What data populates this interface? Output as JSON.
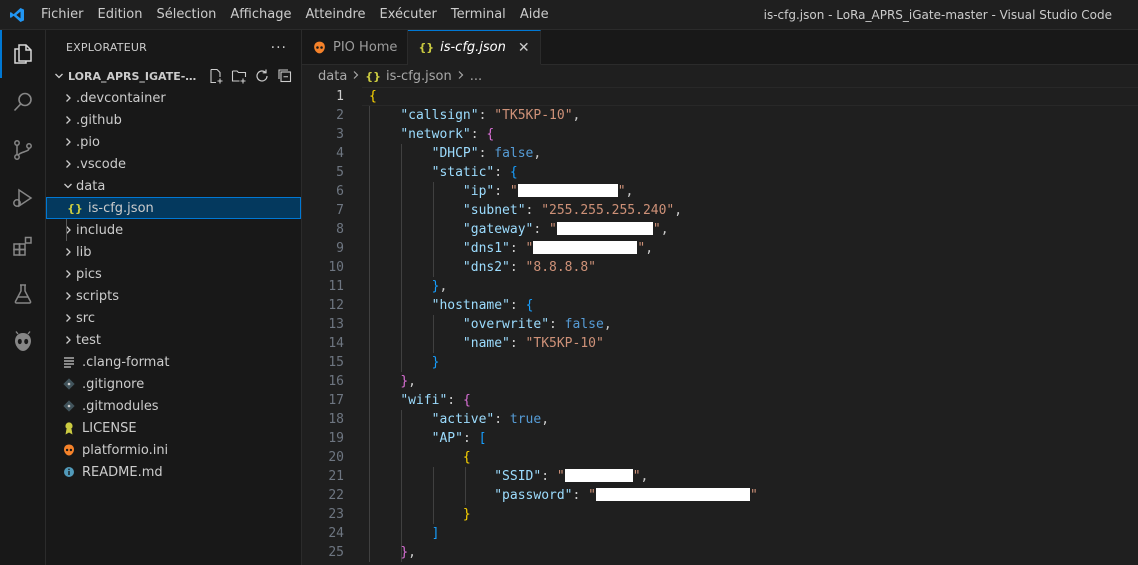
{
  "titlebar": {
    "menu": [
      "Fichier",
      "Edition",
      "Sélection",
      "Affichage",
      "Atteindre",
      "Exécuter",
      "Terminal",
      "Aide"
    ],
    "window_title": "is-cfg.json - LoRa_APRS_iGate-master - Visual Studio Code"
  },
  "sidebar": {
    "header": "EXPLORATEUR",
    "more": "···",
    "section_title": "LORA_APRS_IGATE-MAS...",
    "items": [
      {
        "label": ".devcontainer",
        "type": "folder"
      },
      {
        "label": ".github",
        "type": "folder"
      },
      {
        "label": ".pio",
        "type": "folder"
      },
      {
        "label": ".vscode",
        "type": "folder"
      },
      {
        "label": "data",
        "type": "folder-open"
      },
      {
        "label": "is-cfg.json",
        "type": "json",
        "selected": true
      },
      {
        "label": "include",
        "type": "folder"
      },
      {
        "label": "lib",
        "type": "folder"
      },
      {
        "label": "pics",
        "type": "folder"
      },
      {
        "label": "scripts",
        "type": "folder"
      },
      {
        "label": "src",
        "type": "folder"
      },
      {
        "label": "test",
        "type": "folder"
      },
      {
        "label": ".clang-format",
        "type": "lines"
      },
      {
        "label": ".gitignore",
        "type": "git"
      },
      {
        "label": ".gitmodules",
        "type": "git"
      },
      {
        "label": "LICENSE",
        "type": "license"
      },
      {
        "label": "platformio.ini",
        "type": "platformio"
      },
      {
        "label": "README.md",
        "type": "info"
      }
    ],
    "json_glyph": "{}"
  },
  "tabs": [
    {
      "label": "PIO Home",
      "active": false
    },
    {
      "label": "is-cfg.json",
      "active": true,
      "close": "✕"
    }
  ],
  "breadcrumbs": [
    "data",
    "is-cfg.json",
    "..."
  ],
  "breadcrumb_json_glyph": "{}",
  "editor": {
    "lines": [
      {
        "n": "1"
      },
      {
        "n": "2"
      },
      {
        "n": "3"
      },
      {
        "n": "4"
      },
      {
        "n": "5"
      },
      {
        "n": "6"
      },
      {
        "n": "7"
      },
      {
        "n": "8"
      },
      {
        "n": "9"
      },
      {
        "n": "10"
      },
      {
        "n": "11"
      },
      {
        "n": "12"
      },
      {
        "n": "13"
      },
      {
        "n": "14"
      },
      {
        "n": "15"
      },
      {
        "n": "16"
      },
      {
        "n": "17"
      },
      {
        "n": "18"
      },
      {
        "n": "19"
      },
      {
        "n": "20"
      },
      {
        "n": "21"
      },
      {
        "n": "22"
      },
      {
        "n": "23"
      },
      {
        "n": "24"
      },
      {
        "n": "25"
      }
    ],
    "tokens": {
      "callsign_key": "\"callsign\"",
      "callsign_val": "\"TK5KP-10\"",
      "network_key": "\"network\"",
      "dhcp_key": "\"DHCP\"",
      "false": "false",
      "static_key": "\"static\"",
      "ip_key": "\"ip\"",
      "subnet_key": "\"subnet\"",
      "subnet_val": "\"255.255.255.240\"",
      "gateway_key": "\"gateway\"",
      "dns1_key": "\"dns1\"",
      "dns2_key": "\"dns2\"",
      "dns2_val": "\"8.8.8.8\"",
      "hostname_key": "\"hostname\"",
      "overwrite_key": "\"overwrite\"",
      "name_key": "\"name\"",
      "name_val": "\"TK5KP-10\"",
      "wifi_key": "\"wifi\"",
      "active_key": "\"active\"",
      "true": "true",
      "ap_key": "\"AP\"",
      "ssid_key": "\"SSID\"",
      "password_key": "\"password\""
    }
  },
  "colors": {
    "accent": "#0078d4",
    "vscode_blue": "#2196f3",
    "pio_orange": "#f5822a"
  }
}
